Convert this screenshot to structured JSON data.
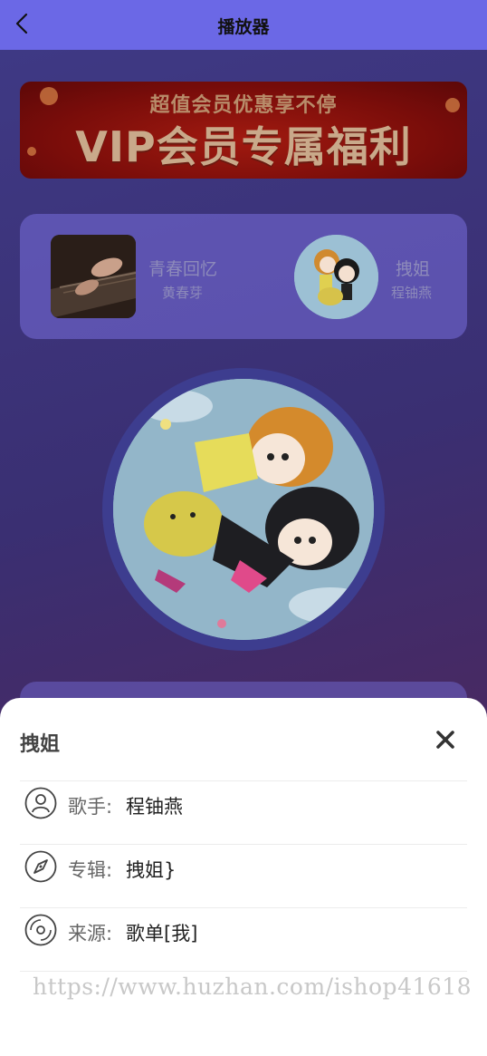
{
  "header": {
    "title": "播放器",
    "back_icon": "chevron-left-icon"
  },
  "banner": {
    "subtitle": "超值会员优惠享不停",
    "headline": "VIP会员专属福利"
  },
  "recent": [
    {
      "name": "青春回忆",
      "artist": "黄春芽"
    },
    {
      "name": "拽姐",
      "artist": "程铀燕"
    }
  ],
  "sheet": {
    "title": "拽姐",
    "close_icon": "close-icon",
    "rows": [
      {
        "icon": "user-icon",
        "label": "歌手:",
        "value": "程铀燕"
      },
      {
        "icon": "compass-icon",
        "label": "专辑:",
        "value": "拽姐}"
      },
      {
        "icon": "disc-icon",
        "label": "来源:",
        "value": "歌单[我]"
      }
    ]
  },
  "watermark": "https://www.huzhan.com/ishop41618",
  "colors": {
    "header_bg": "#6b68e6",
    "sheet_bg": "#ffffff",
    "banner_red": "#8a120c"
  }
}
